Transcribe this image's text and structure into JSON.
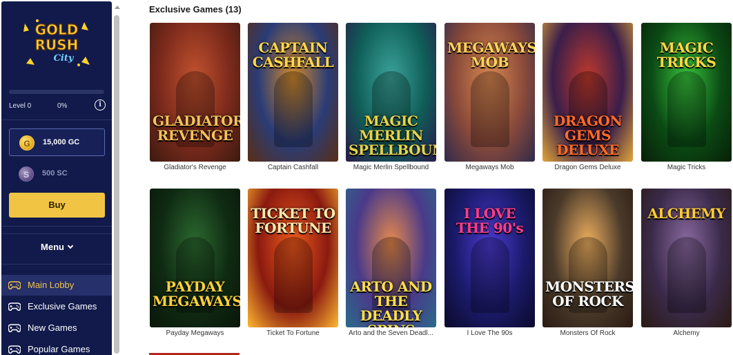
{
  "sidebar": {
    "logo": {
      "line1": "GOLD",
      "line2": "RUSH",
      "line3": "City"
    },
    "level": {
      "label": "Level 0",
      "percent_text": "0%",
      "progress": 0
    },
    "wallet": {
      "gc": "15,000 GC",
      "sc": "500 SC",
      "gc_symbol": "G",
      "sc_symbol": "S"
    },
    "buy_label": "Buy",
    "menu_label": "Menu",
    "nav": [
      {
        "label": "Main Lobby",
        "icon": "gamepad-icon",
        "active": true
      },
      {
        "label": "Exclusive Games",
        "icon": "gamepad-icon",
        "active": false
      },
      {
        "label": "New Games",
        "icon": "gamepad-icon",
        "active": false
      },
      {
        "label": "Popular Games",
        "icon": "gamepad-icon",
        "active": false
      }
    ],
    "info_symbol": "i"
  },
  "main": {
    "section_title": "Exclusive Games (13)",
    "games": [
      {
        "art_title": "GLADIATORS REVENGE",
        "caption": "Gladiator's Revenge",
        "colors": [
          "#7c2a1c",
          "#c2522e",
          "#3b1a10"
        ],
        "title_color": "#f2c35a"
      },
      {
        "art_title": "CAPTAIN CASHFALL",
        "caption": "Captain Cashfall",
        "colors": [
          "#2a3c77",
          "#d38a2a",
          "#5a2e12"
        ],
        "title_color": "#ffd84a"
      },
      {
        "art_title": "MAGIC MERLIN SPELLBOUND",
        "caption": "Magic Merlin Spellbound",
        "colors": [
          "#0f5e58",
          "#3aa39a",
          "#2b1a4a"
        ],
        "title_color": "#e7d24b"
      },
      {
        "art_title": "MEGAWAYS MOB",
        "caption": "Megaways Mob",
        "colors": [
          "#8a4a3a",
          "#d88850",
          "#2f2a4a"
        ],
        "title_color": "#ffd35c"
      },
      {
        "art_title": "DRAGON GEMS DELUXE",
        "caption": "Dragon Gems Deluxe",
        "colors": [
          "#3a1e4a",
          "#c0392b",
          "#e2a63a"
        ],
        "title_color": "#ff6a2a"
      },
      {
        "art_title": "MAGIC TRICKS",
        "caption": "Magic Tricks",
        "colors": [
          "#0b4a14",
          "#38c23c",
          "#071f08"
        ],
        "title_color": "#ffd845"
      },
      {
        "art_title": "PAYDAY MEGAWAYS",
        "caption": "Payday Megaways",
        "colors": [
          "#0f2a12",
          "#2c6a30",
          "#0a160a"
        ],
        "title_color": "#ffd23a"
      },
      {
        "art_title": "TICKET TO FORTUNE",
        "caption": "Ticket To Fortune",
        "colors": [
          "#8a1a10",
          "#f05a1c",
          "#ffb830"
        ],
        "title_color": "#ffe9b0"
      },
      {
        "art_title": "ARTO AND THE DEADLY SPINS",
        "caption": "Arto and the Seven Deadl...",
        "colors": [
          "#4a3a8a",
          "#e88a4a",
          "#2a6a8a"
        ],
        "title_color": "#ffe04a"
      },
      {
        "art_title": "I LOVE THE 90's",
        "caption": "I Love The 90s",
        "colors": [
          "#1b1a6a",
          "#4a3ad0",
          "#0a0a2a"
        ],
        "title_color": "#ff3d8a"
      },
      {
        "art_title": "MONSTERS OF ROCK",
        "caption": "Monsters Of Rock",
        "colors": [
          "#4a3a2a",
          "#f0b060",
          "#2a1a12"
        ],
        "title_color": "#ffffff"
      },
      {
        "art_title": "ALCHEMY",
        "caption": "Alchemy",
        "colors": [
          "#3a2a4a",
          "#8a6aa0",
          "#2a1a12"
        ],
        "title_color": "#ffcc33"
      }
    ]
  },
  "colors": {
    "sidebar_bg": "#111a4a",
    "accent_gold": "#f2c443",
    "active_nav_bg": "#26306a"
  }
}
